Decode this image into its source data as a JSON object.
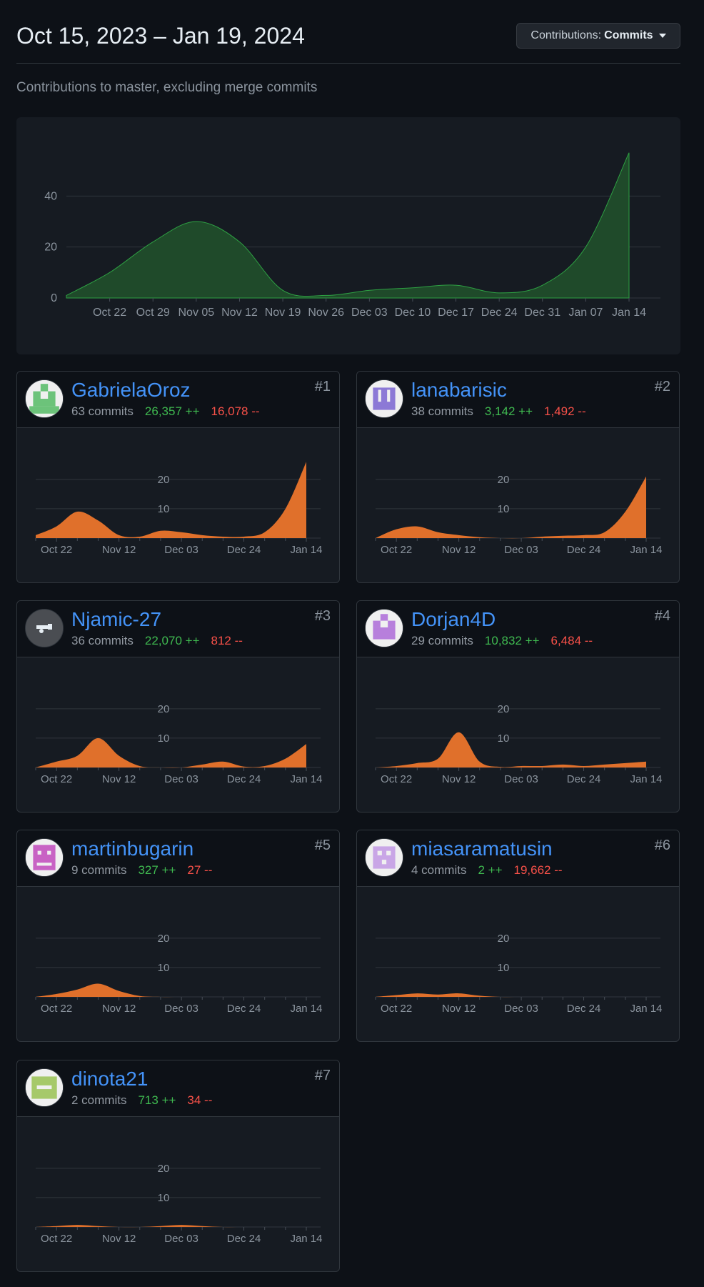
{
  "header": {
    "range_title": "Oct 15, 2023 – Jan 19, 2024",
    "contributions_prefix": "Contributions:",
    "contributions_value": "Commits"
  },
  "subtitle": "Contributions to master, excluding merge commits",
  "colors": {
    "main_area": "#1f4a2a",
    "main_line": "#2ea043",
    "contributor_area": "#e0702b",
    "additions": "#3fb950",
    "deletions": "#f85149",
    "link": "#4493f8"
  },
  "chart_data": [
    {
      "type": "area",
      "x": [
        "Oct 15",
        "Oct 22",
        "Oct 29",
        "Nov 05",
        "Nov 12",
        "Nov 19",
        "Nov 26",
        "Dec 03",
        "Dec 10",
        "Dec 17",
        "Dec 24",
        "Dec 31",
        "Jan 07",
        "Jan 14"
      ],
      "tick_labels": [
        "Oct 22",
        "Oct 29",
        "Nov 05",
        "Nov 12",
        "Nov 19",
        "Nov 26",
        "Dec 03",
        "Dec 10",
        "Dec 17",
        "Dec 24",
        "Dec 31",
        "Jan 07",
        "Jan 14"
      ],
      "values": [
        1,
        10,
        22,
        30,
        22,
        3,
        1,
        3,
        4,
        5,
        2,
        5,
        20,
        57
      ],
      "yticks": [
        0,
        20,
        40
      ],
      "ylim": [
        0,
        60
      ],
      "grid": true
    },
    {
      "type": "area",
      "x": [
        "Oct 15",
        "Oct 22",
        "Oct 29",
        "Nov 05",
        "Nov 12",
        "Nov 19",
        "Nov 26",
        "Dec 03",
        "Dec 10",
        "Dec 17",
        "Dec 24",
        "Dec 31",
        "Jan 07",
        "Jan 14"
      ],
      "tick_labels": [
        "Oct 22",
        "Nov 12",
        "Dec 03",
        "Dec 24",
        "Jan 14"
      ],
      "values": [
        1,
        4,
        9,
        6,
        1,
        0.5,
        2.5,
        2,
        1,
        0.5,
        0.5,
        2,
        10,
        26
      ],
      "yticks": [
        10,
        20
      ],
      "ylim": [
        0,
        28
      ]
    },
    {
      "type": "area",
      "x": [
        "Oct 15",
        "Oct 22",
        "Oct 29",
        "Nov 05",
        "Nov 12",
        "Nov 19",
        "Nov 26",
        "Dec 03",
        "Dec 10",
        "Dec 17",
        "Dec 24",
        "Dec 31",
        "Jan 07",
        "Jan 14"
      ],
      "tick_labels": [
        "Oct 22",
        "Nov 12",
        "Dec 03",
        "Dec 24",
        "Jan 14"
      ],
      "values": [
        0,
        3,
        4,
        2,
        1,
        0.3,
        0,
        0,
        0.5,
        0.8,
        1,
        2,
        9,
        21
      ],
      "yticks": [
        10,
        20
      ],
      "ylim": [
        0,
        28
      ]
    },
    {
      "type": "area",
      "x": [
        "Oct 15",
        "Oct 22",
        "Oct 29",
        "Nov 05",
        "Nov 12",
        "Nov 19",
        "Nov 26",
        "Dec 03",
        "Dec 10",
        "Dec 17",
        "Dec 24",
        "Dec 31",
        "Jan 07",
        "Jan 14"
      ],
      "tick_labels": [
        "Oct 22",
        "Nov 12",
        "Dec 03",
        "Dec 24",
        "Jan 14"
      ],
      "values": [
        0,
        2,
        4,
        10,
        4,
        0.5,
        0,
        0,
        1,
        2,
        0.3,
        0.5,
        3,
        8
      ],
      "yticks": [
        10,
        20
      ],
      "ylim": [
        0,
        28
      ]
    },
    {
      "type": "area",
      "x": [
        "Oct 15",
        "Oct 22",
        "Oct 29",
        "Nov 05",
        "Nov 12",
        "Nov 19",
        "Nov 26",
        "Dec 03",
        "Dec 10",
        "Dec 17",
        "Dec 24",
        "Dec 31",
        "Jan 07",
        "Jan 14"
      ],
      "tick_labels": [
        "Oct 22",
        "Nov 12",
        "Dec 03",
        "Dec 24",
        "Jan 14"
      ],
      "values": [
        0,
        0.5,
        1.5,
        3,
        12,
        2,
        0.2,
        0.5,
        0.5,
        1,
        0.5,
        1,
        1.5,
        2
      ],
      "yticks": [
        10,
        20
      ],
      "ylim": [
        0,
        28
      ]
    },
    {
      "type": "area",
      "x": [
        "Oct 15",
        "Oct 22",
        "Oct 29",
        "Nov 05",
        "Nov 12",
        "Nov 19",
        "Nov 26",
        "Dec 03",
        "Dec 10",
        "Dec 17",
        "Dec 24",
        "Dec 31",
        "Jan 07",
        "Jan 14"
      ],
      "tick_labels": [
        "Oct 22",
        "Nov 12",
        "Dec 03",
        "Dec 24",
        "Jan 14"
      ],
      "values": [
        0,
        1,
        2.5,
        4.5,
        2,
        0.3,
        0,
        0,
        0,
        0,
        0,
        0,
        0,
        0
      ],
      "yticks": [
        10,
        20
      ],
      "ylim": [
        0,
        28
      ]
    },
    {
      "type": "area",
      "x": [
        "Oct 15",
        "Oct 22",
        "Oct 29",
        "Nov 05",
        "Nov 12",
        "Nov 19",
        "Nov 26",
        "Dec 03",
        "Dec 10",
        "Dec 17",
        "Dec 24",
        "Dec 31",
        "Jan 07",
        "Jan 14"
      ],
      "tick_labels": [
        "Oct 22",
        "Nov 12",
        "Dec 03",
        "Dec 24",
        "Jan 14"
      ],
      "values": [
        0,
        0.6,
        1.2,
        0.8,
        1.2,
        0.4,
        0,
        0,
        0,
        0,
        0,
        0,
        0,
        0
      ],
      "yticks": [
        10,
        20
      ],
      "ylim": [
        0,
        28
      ]
    },
    {
      "type": "area",
      "x": [
        "Oct 15",
        "Oct 22",
        "Oct 29",
        "Nov 05",
        "Nov 12",
        "Nov 19",
        "Nov 26",
        "Dec 03",
        "Dec 10",
        "Dec 17",
        "Dec 24",
        "Dec 31",
        "Jan 07",
        "Jan 14"
      ],
      "tick_labels": [
        "Oct 22",
        "Nov 12",
        "Dec 03",
        "Dec 24",
        "Jan 14"
      ],
      "values": [
        0,
        0.3,
        0.7,
        0.3,
        0,
        0,
        0.3,
        0.7,
        0.3,
        0,
        0,
        0,
        0,
        0
      ],
      "yticks": [
        10,
        20
      ],
      "ylim": [
        0,
        28
      ]
    }
  ],
  "contributors": [
    {
      "name": "GabrielaOroz",
      "rank": "#1",
      "commits": "63 commits",
      "additions": "26,357 ++",
      "deletions": "16,078 --",
      "avatar_icon": "identicon-green-icon"
    },
    {
      "name": "lanabarisic",
      "rank": "#2",
      "commits": "38 commits",
      "additions": "3,142 ++",
      "deletions": "1,492 --",
      "avatar_icon": "identicon-purple-w-icon"
    },
    {
      "name": "Njamic-27",
      "rank": "#3",
      "commits": "36 commits",
      "additions": "22,070 ++",
      "deletions": "812 --",
      "avatar_icon": "cannon-logo-icon"
    },
    {
      "name": "Dorjan4D",
      "rank": "#4",
      "commits": "29 commits",
      "additions": "10,832 ++",
      "deletions": "6,484 --",
      "avatar_icon": "identicon-violet-icon"
    },
    {
      "name": "martinbugarin",
      "rank": "#5",
      "commits": "9 commits",
      "additions": "327 ++",
      "deletions": "27 --",
      "avatar_icon": "identicon-magenta-icon"
    },
    {
      "name": "miasaramatusin",
      "rank": "#6",
      "commits": "4 commits",
      "additions": "2 ++",
      "deletions": "19,662 --",
      "avatar_icon": "identicon-lavender-icon"
    },
    {
      "name": "dinota21",
      "rank": "#7",
      "commits": "2 commits",
      "additions": "713 ++",
      "deletions": "34 --",
      "avatar_icon": "identicon-lime-icon"
    }
  ]
}
